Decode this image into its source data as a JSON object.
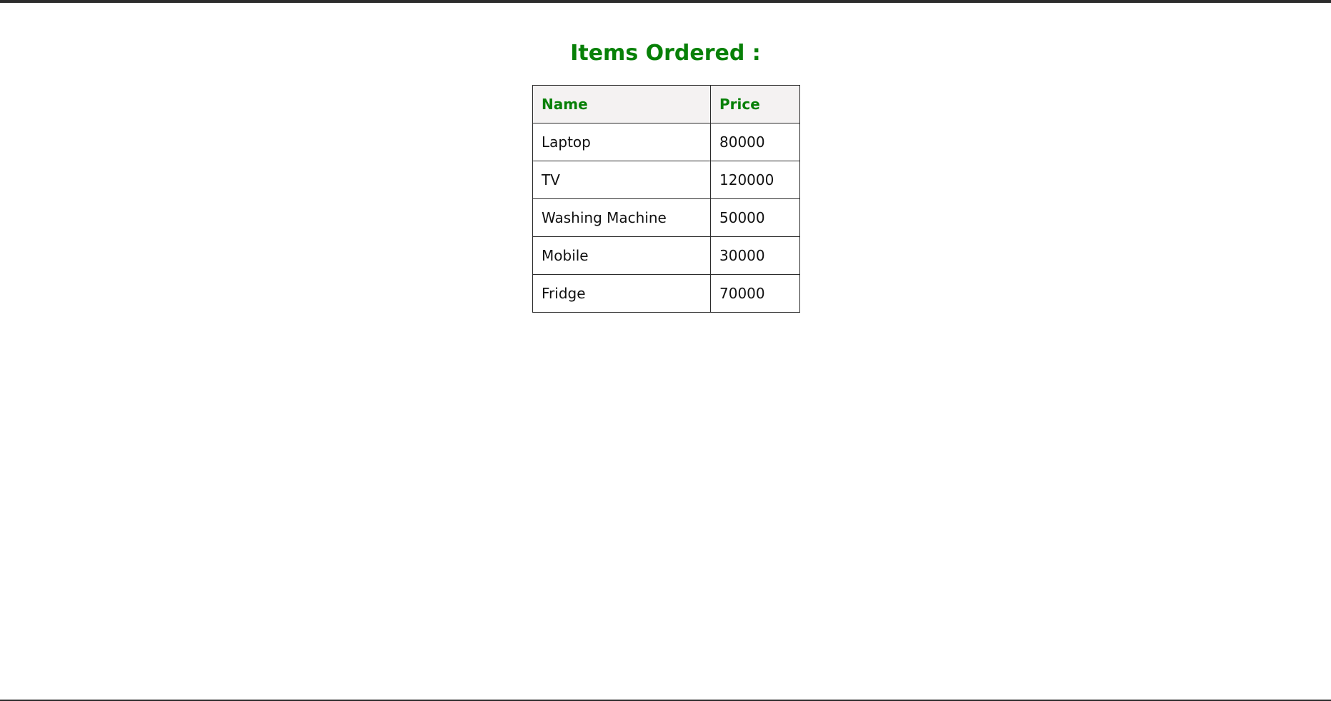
{
  "heading": "Items Ordered :",
  "table": {
    "columns": [
      "Name",
      "Price"
    ],
    "rows": [
      {
        "name": "Laptop",
        "price": "80000"
      },
      {
        "name": "TV",
        "price": "120000"
      },
      {
        "name": "Washing Machine",
        "price": "50000"
      },
      {
        "name": "Mobile",
        "price": "30000"
      },
      {
        "name": "Fridge",
        "price": "70000"
      }
    ]
  },
  "colors": {
    "accent": "#078007",
    "header_bg": "#f4f2f2",
    "border": "#2b2b2b"
  }
}
